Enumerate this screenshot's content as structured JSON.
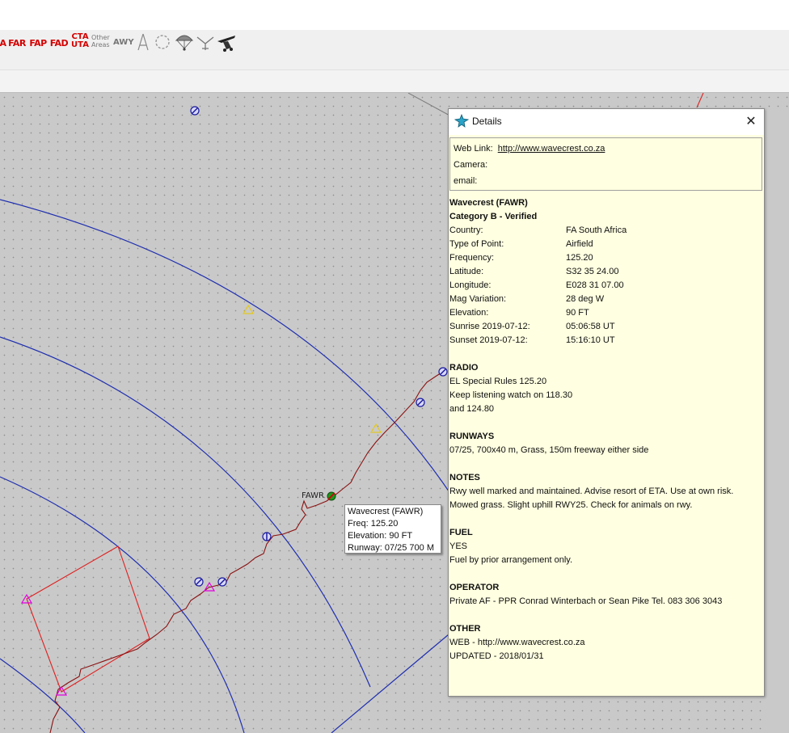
{
  "toolbar": {
    "items": [
      {
        "label": "A",
        "icon": "area-a-icon"
      },
      {
        "label": "FAR"
      },
      {
        "label": "FAP"
      },
      {
        "label": "FAD"
      },
      {
        "label": "CTA",
        "label2": "UTA"
      },
      {
        "label": "Other",
        "label2": "Areas"
      },
      {
        "label": "AWY"
      }
    ],
    "icons": [
      "tower-icon",
      "circle-dashed-icon",
      "parachute-icon",
      "glider-icon",
      "microlight-icon"
    ]
  },
  "map": {
    "airfield_label": "FAWR",
    "tooltip": {
      "line1": "Wavecrest (FAWR)",
      "line2": "Freq: 125.20",
      "line3": "Elevation: 90 FT",
      "line4": "Runway: 07/25  700 M"
    }
  },
  "details": {
    "title": "Details",
    "web_link_label": "Web Link:",
    "web_link": "http://www.wavecrest.co.za",
    "camera_label": "Camera:",
    "email_label": "email:",
    "name": "Wavecrest (FAWR)",
    "category": "Category B - Verified",
    "fields": [
      {
        "k": "Country:",
        "v": "FA South Africa"
      },
      {
        "k": "Type of Point:",
        "v": "Airfield"
      },
      {
        "k": "Frequency:",
        "v": "125.20"
      },
      {
        "k": "Latitude:",
        "v": "S32 35 24.00"
      },
      {
        "k": "Longitude:",
        "v": "E028 31 07.00"
      },
      {
        "k": "Mag Variation:",
        "v": "28 deg W"
      },
      {
        "k": "Elevation:",
        "v": "90 FT"
      },
      {
        "k": "Sunrise 2019-07-12:",
        "v": "05:06:58 UT"
      },
      {
        "k": "Sunset 2019-07-12:",
        "v": "15:16:10 UT"
      }
    ],
    "radio_heading": "RADIO",
    "radio_lines": [
      "EL Special Rules 125.20",
      "Keep listening watch on 118.30",
      "and 124.80"
    ],
    "runways_heading": "RUNWAYS",
    "runways_line": "07/25, 700x40 m, Grass, 150m freeway either side",
    "notes_heading": "NOTES",
    "notes_lines": [
      "Rwy well marked and maintained. Advise resort of ETA. Use at own risk.",
      "Mowed grass. Slight uphill RWY25. Check for animals on rwy."
    ],
    "fuel_heading": "FUEL",
    "fuel_lines": [
      "YES",
      "Fuel by prior arrangement only."
    ],
    "operator_heading": "OPERATOR",
    "operator_line": "Private AF - PPR  Conrad Winterbach or Sean Pike Tel. 083 306 3043",
    "other_heading": "OTHER",
    "other_lines": [
      "WEB - http://www.wavecrest.co.za",
      "UPDATED - 2018/01/31"
    ]
  }
}
